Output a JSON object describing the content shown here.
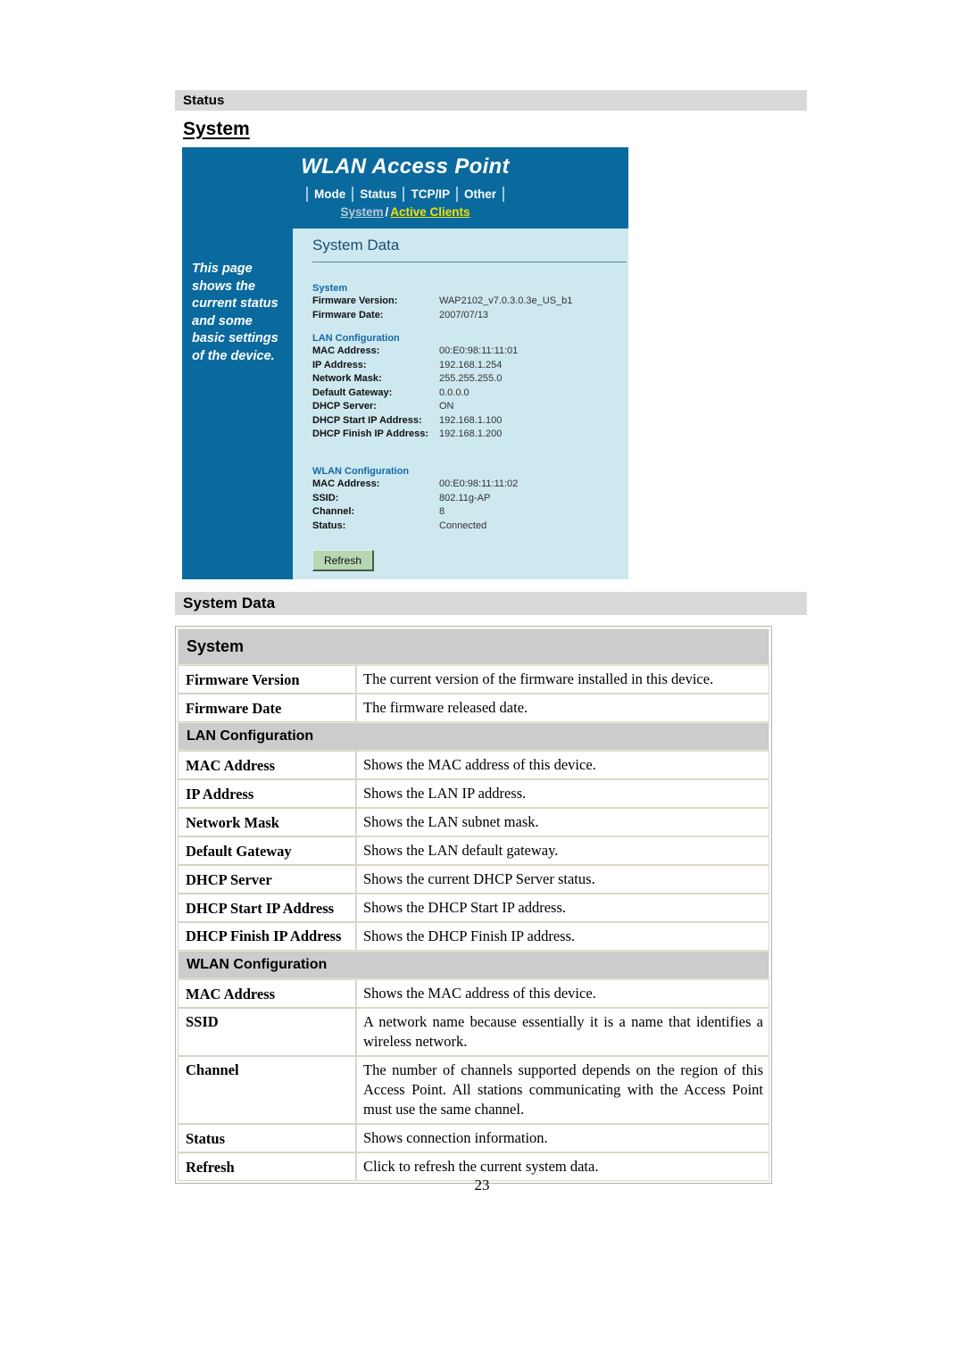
{
  "sections": {
    "status_band": "Status",
    "system_heading": "System",
    "system_data_band": "System Data"
  },
  "device_screenshot": {
    "title": "WLAN Access Point",
    "tabs": [
      "Mode",
      "Status",
      "TCP/IP",
      "Other"
    ],
    "subnav": {
      "system": "System",
      "separator": "/",
      "active_clients": "Active Clients"
    },
    "sidebar_text": "This page shows the current status and some basic settings of the device.",
    "panel_title": "System Data",
    "groups": [
      {
        "title": "System",
        "rows": [
          {
            "label": "Firmware Version:",
            "value": "WAP2102_v7.0.3.0.3e_US_b1"
          },
          {
            "label": "Firmware Date:",
            "value": "2007/07/13"
          }
        ]
      },
      {
        "title": "LAN Configuration",
        "rows": [
          {
            "label": "MAC Address:",
            "value": "00:E0:98:11:11:01"
          },
          {
            "label": "IP Address:",
            "value": "192.168.1.254"
          },
          {
            "label": "Network Mask:",
            "value": "255.255.255.0"
          },
          {
            "label": "Default Gateway:",
            "value": "0.0.0.0"
          },
          {
            "label": "DHCP Server:",
            "value": "ON"
          },
          {
            "label": "DHCP Start IP Address:",
            "value": "192.168.1.100"
          },
          {
            "label": "DHCP Finish IP Address:",
            "value": "192.168.1.200"
          }
        ]
      },
      {
        "title": "WLAN Configuration",
        "rows": [
          {
            "label": "MAC Address:",
            "value": "00:E0:98:11:11:02"
          },
          {
            "label": "SSID:",
            "value": "802.11g-AP"
          },
          {
            "label": "Channel:",
            "value": "8"
          },
          {
            "label": "Status:",
            "value": "Connected"
          }
        ]
      }
    ],
    "refresh_button": "Refresh",
    "colors": {
      "header_blue": "#0a6a9e",
      "panel_blue": "#cde8ee",
      "active_link_yellow": "#f2e000",
      "button_green": "#b7d6b2"
    }
  },
  "table": {
    "group_system": "System",
    "group_lan": "LAN Configuration",
    "group_wlan": "WLAN Configuration",
    "rows_system": [
      {
        "key": "Firmware Version",
        "desc": "The current version of the firmware installed in this device."
      },
      {
        "key": "Firmware Date",
        "desc": "The firmware released date."
      }
    ],
    "rows_lan": [
      {
        "key": "MAC Address",
        "desc": "Shows the MAC address of this device."
      },
      {
        "key": "IP Address",
        "desc": "Shows the LAN IP address."
      },
      {
        "key": "Network Mask",
        "desc": "Shows the LAN subnet mask."
      },
      {
        "key": "Default Gateway",
        "desc": "Shows the LAN default gateway."
      },
      {
        "key": "DHCP Server",
        "desc": "Shows the current DHCP Server status."
      },
      {
        "key": "DHCP Start IP Address",
        "desc": "Shows the DHCP Start IP address."
      },
      {
        "key": "DHCP Finish IP Address",
        "desc": "Shows the DHCP Finish IP address."
      }
    ],
    "rows_wlan": [
      {
        "key": "MAC Address",
        "desc": "Shows the MAC address of this device."
      },
      {
        "key": "SSID",
        "desc": "A network name because essentially it is a name that identifies a wireless network."
      },
      {
        "key": "Channel",
        "desc": "The number of channels supported depends on the region of this Access Point. All stations communicating with the Access Point must use the same channel."
      },
      {
        "key": "Status",
        "desc": "Shows connection information."
      },
      {
        "key": "Refresh",
        "desc": "Click to refresh the current system data."
      }
    ]
  },
  "page_number": "23"
}
